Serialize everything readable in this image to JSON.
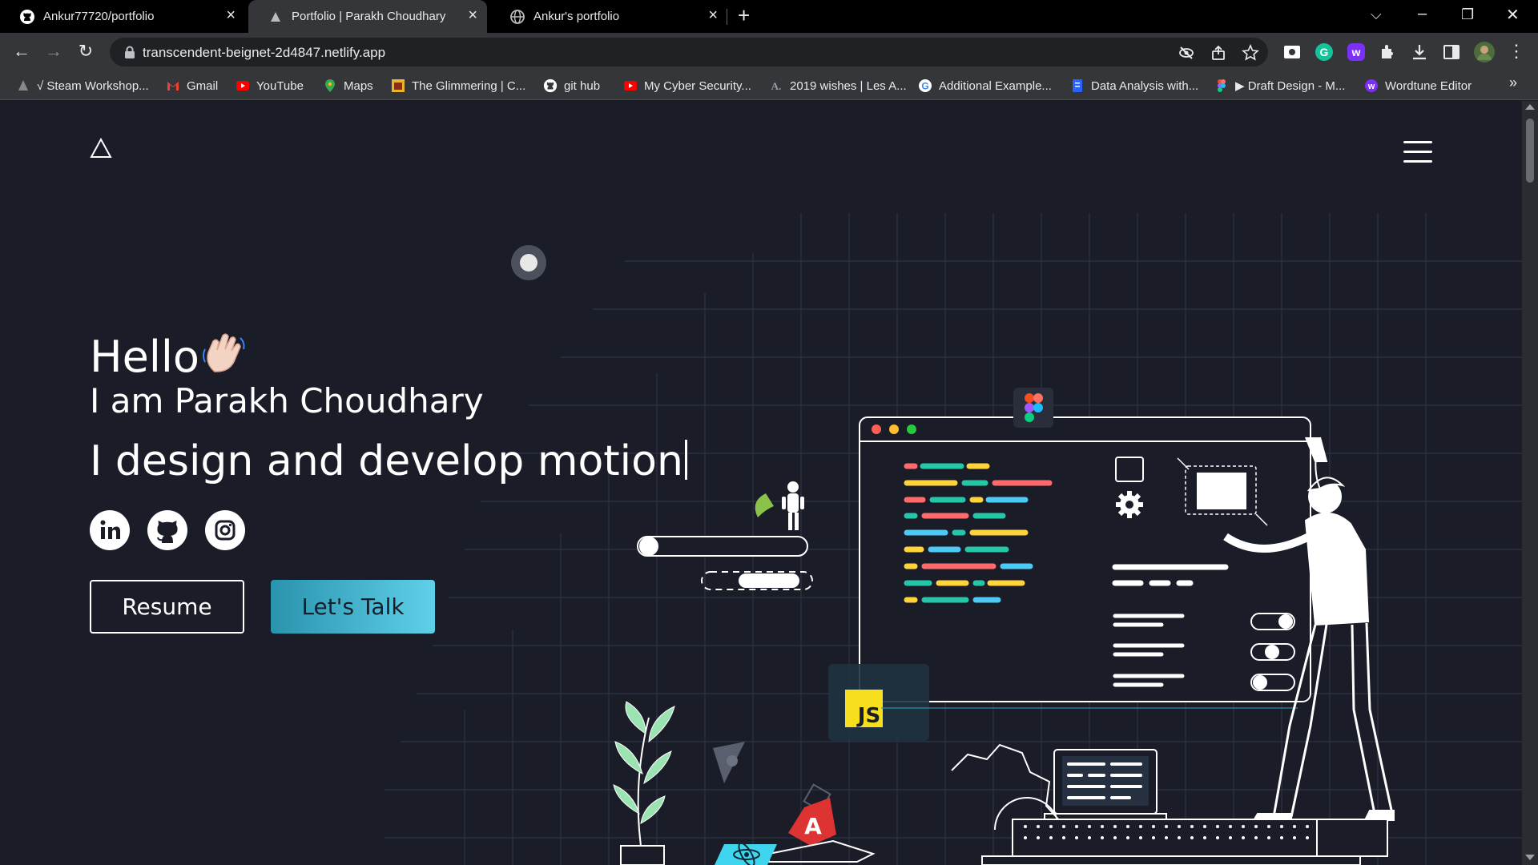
{
  "browser": {
    "tabs": [
      {
        "title": "Ankur77720/portfolio",
        "icon": "github-icon",
        "active": false
      },
      {
        "title": "Portfolio | Parakh Choudhary",
        "icon": "site-triangle-icon",
        "active": true
      },
      {
        "title": "Ankur's portfolio",
        "icon": "globe-icon",
        "active": false
      }
    ],
    "url": "transcendent-beignet-2d4847.netlify.app",
    "bookmarks": [
      {
        "label": "√ Steam Workshop...",
        "icon": "steam-icon"
      },
      {
        "label": "Gmail",
        "icon": "gmail-icon"
      },
      {
        "label": "YouTube",
        "icon": "youtube-icon"
      },
      {
        "label": "Maps",
        "icon": "maps-icon"
      },
      {
        "label": "The Glimmering | C...",
        "icon": "bookmark-app-icon"
      },
      {
        "label": "git hub",
        "icon": "github-icon"
      },
      {
        "label": "My Cyber Security...",
        "icon": "youtube-icon"
      },
      {
        "label": "2019 wishes | Les A...",
        "icon": "letter-a-icon"
      },
      {
        "label": "Additional Example...",
        "icon": "google-icon"
      },
      {
        "label": "Data Analysis with...",
        "icon": "doc-icon"
      },
      {
        "label": "▶ Draft Design - M...",
        "icon": "figma-icon"
      },
      {
        "label": "Wordtune Editor",
        "icon": "wordtune-icon"
      }
    ]
  },
  "hero": {
    "greeting": "Hello",
    "name_line": "I am Parakh Choudhary",
    "typed_text": "I design and develop motion"
  },
  "buttons": {
    "resume": "Resume",
    "talk": "Let's Talk"
  },
  "illustration": {
    "badge_js": "JS"
  },
  "colors": {
    "page_bg": "#1a1c28",
    "accent_start": "#2a93ad",
    "accent_end": "#5fd0e8"
  }
}
